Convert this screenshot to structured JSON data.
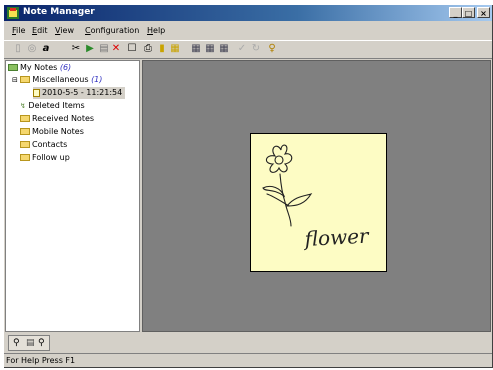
{
  "window": {
    "title": "Note Manager"
  },
  "window_buttons": {
    "minimize": "_",
    "maximize": "□",
    "close": "×"
  },
  "menu": [
    {
      "label": "File",
      "key": "F",
      "rest": "ile"
    },
    {
      "label": "Edit",
      "key": "E",
      "rest": "dit"
    },
    {
      "label": "View",
      "key": "V",
      "rest": "iew"
    },
    {
      "label": "Configuration",
      "key": "C",
      "rest": "onfiguration"
    },
    {
      "label": "Help",
      "key": "H",
      "rest": "elp"
    }
  ],
  "tree": {
    "root": {
      "label": "My Notes",
      "count": "(6)"
    },
    "misc": {
      "label": "Miscellaneous",
      "count": "(1)"
    },
    "note": {
      "label": "2010-5-5 - 11:21:54"
    },
    "deleted": {
      "label": "Deleted Items"
    },
    "received": {
      "label": "Received Notes"
    },
    "mobile": {
      "label": "Mobile Notes"
    },
    "contacts": {
      "label": "Contacts"
    },
    "followup": {
      "label": "Follow up"
    }
  },
  "note_content": {
    "text": "flower"
  },
  "status": {
    "text": "For Help Press F1"
  }
}
